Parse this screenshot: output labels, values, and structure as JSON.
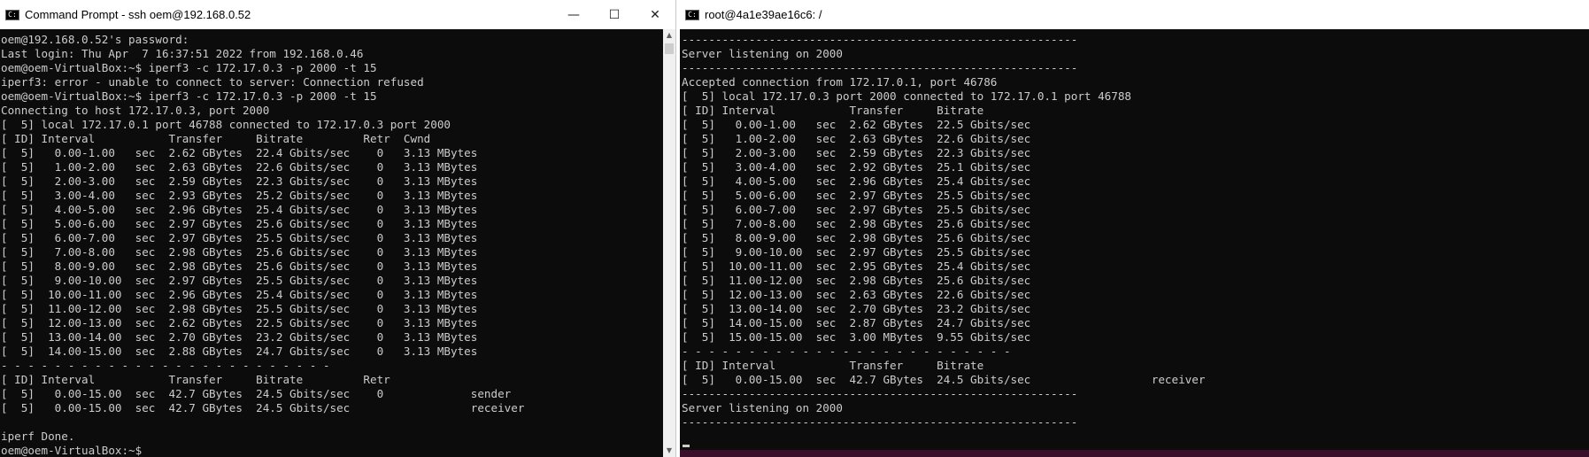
{
  "left_window": {
    "title": "Command Prompt - ssh  oem@192.168.0.52",
    "icon": "cmd-icon",
    "controls": {
      "minimize": "—",
      "maximize": "☐",
      "close": "✕"
    },
    "lines": [
      "oem@192.168.0.52's password:",
      "Last login: Thu Apr  7 16:37:51 2022 from 192.168.0.46",
      "oem@oem-VirtualBox:~$ iperf3 -c 172.17.0.3 -p 2000 -t 15",
      "iperf3: error - unable to connect to server: Connection refused",
      "oem@oem-VirtualBox:~$ iperf3 -c 172.17.0.3 -p 2000 -t 15",
      "Connecting to host 172.17.0.3, port 2000",
      "[  5] local 172.17.0.1 port 46788 connected to 172.17.0.3 port 2000",
      "[ ID] Interval           Transfer     Bitrate         Retr  Cwnd",
      "[  5]   0.00-1.00   sec  2.62 GBytes  22.4 Gbits/sec    0   3.13 MBytes",
      "[  5]   1.00-2.00   sec  2.63 GBytes  22.6 Gbits/sec    0   3.13 MBytes",
      "[  5]   2.00-3.00   sec  2.59 GBytes  22.3 Gbits/sec    0   3.13 MBytes",
      "[  5]   3.00-4.00   sec  2.93 GBytes  25.2 Gbits/sec    0   3.13 MBytes",
      "[  5]   4.00-5.00   sec  2.96 GBytes  25.4 Gbits/sec    0   3.13 MBytes",
      "[  5]   5.00-6.00   sec  2.97 GBytes  25.6 Gbits/sec    0   3.13 MBytes",
      "[  5]   6.00-7.00   sec  2.97 GBytes  25.5 Gbits/sec    0   3.13 MBytes",
      "[  5]   7.00-8.00   sec  2.98 GBytes  25.6 Gbits/sec    0   3.13 MBytes",
      "[  5]   8.00-9.00   sec  2.98 GBytes  25.6 Gbits/sec    0   3.13 MBytes",
      "[  5]   9.00-10.00  sec  2.97 GBytes  25.5 Gbits/sec    0   3.13 MBytes",
      "[  5]  10.00-11.00  sec  2.96 GBytes  25.4 Gbits/sec    0   3.13 MBytes",
      "[  5]  11.00-12.00  sec  2.98 GBytes  25.5 Gbits/sec    0   3.13 MBytes",
      "[  5]  12.00-13.00  sec  2.62 GBytes  22.5 Gbits/sec    0   3.13 MBytes",
      "[  5]  13.00-14.00  sec  2.70 GBytes  23.2 Gbits/sec    0   3.13 MBytes",
      "[  5]  14.00-15.00  sec  2.88 GBytes  24.7 Gbits/sec    0   3.13 MBytes",
      "- - - - - - - - - - - - - - - - - - - - - - - - -",
      "[ ID] Interval           Transfer     Bitrate         Retr",
      "[  5]   0.00-15.00  sec  42.7 GBytes  24.5 Gbits/sec    0             sender",
      "[  5]   0.00-15.00  sec  42.7 GBytes  24.5 Gbits/sec                  receiver",
      "",
      "iperf Done.",
      "oem@oem-VirtualBox:~$"
    ]
  },
  "right_window": {
    "title": "root@4a1e39ae16c6: /",
    "icon": "cmd-icon",
    "lines": [
      "-----------------------------------------------------------",
      "Server listening on 2000",
      "-----------------------------------------------------------",
      "Accepted connection from 172.17.0.1, port 46786",
      "[  5] local 172.17.0.3 port 2000 connected to 172.17.0.1 port 46788",
      "[ ID] Interval           Transfer     Bitrate",
      "[  5]   0.00-1.00   sec  2.62 GBytes  22.5 Gbits/sec",
      "[  5]   1.00-2.00   sec  2.63 GBytes  22.6 Gbits/sec",
      "[  5]   2.00-3.00   sec  2.59 GBytes  22.3 Gbits/sec",
      "[  5]   3.00-4.00   sec  2.92 GBytes  25.1 Gbits/sec",
      "[  5]   4.00-5.00   sec  2.96 GBytes  25.4 Gbits/sec",
      "[  5]   5.00-6.00   sec  2.97 GBytes  25.5 Gbits/sec",
      "[  5]   6.00-7.00   sec  2.97 GBytes  25.5 Gbits/sec",
      "[  5]   7.00-8.00   sec  2.98 GBytes  25.6 Gbits/sec",
      "[  5]   8.00-9.00   sec  2.98 GBytes  25.6 Gbits/sec",
      "[  5]   9.00-10.00  sec  2.97 GBytes  25.5 Gbits/sec",
      "[  5]  10.00-11.00  sec  2.95 GBytes  25.4 Gbits/sec",
      "[  5]  11.00-12.00  sec  2.98 GBytes  25.6 Gbits/sec",
      "[  5]  12.00-13.00  sec  2.63 GBytes  22.6 Gbits/sec",
      "[  5]  13.00-14.00  sec  2.70 GBytes  23.2 Gbits/sec",
      "[  5]  14.00-15.00  sec  2.87 GBytes  24.7 Gbits/sec",
      "[  5]  15.00-15.00  sec  3.00 MBytes  9.55 Gbits/sec",
      "- - - - - - - - - - - - - - - - - - - - - - - - -",
      "[ ID] Interval           Transfer     Bitrate",
      "[  5]   0.00-15.00  sec  42.7 GBytes  24.5 Gbits/sec                  receiver",
      "-----------------------------------------------------------",
      "Server listening on 2000",
      "-----------------------------------------------------------"
    ]
  },
  "colors": {
    "console_bg": "#0c0c0c",
    "console_fg": "#cccccc",
    "titlebar_bg": "#ffffff"
  }
}
